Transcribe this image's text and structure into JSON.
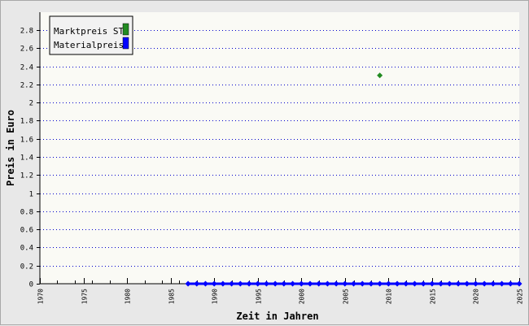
{
  "chart_data": {
    "type": "scatter",
    "title": "",
    "xlabel": "Zeit in Jahren",
    "ylabel": "Preis in Euro",
    "xlim": [
      1970,
      2025
    ],
    "ylim": [
      0,
      2.8
    ],
    "x_ticks": [
      1970,
      1975,
      1980,
      1985,
      1990,
      1995,
      2000,
      2005,
      2010,
      2015,
      2020,
      2025
    ],
    "y_ticks": [
      "0",
      "0.2",
      "0.4",
      "0.6",
      "0.8",
      "1",
      "1.2",
      "1.4",
      "1.6",
      "1.8",
      "2",
      "2.2",
      "2.4",
      "2.6",
      "2.8"
    ],
    "grid": "horizontal dotted",
    "legend_position": "top-left",
    "series": [
      {
        "name": "Marktpreis ST",
        "color": "#228b22",
        "points": [
          [
            2009,
            2.3
          ]
        ]
      },
      {
        "name": "Materialpreis",
        "color": "#0000ff",
        "points": [
          [
            1987,
            0
          ],
          [
            1988,
            0
          ],
          [
            1989,
            0
          ],
          [
            1990,
            0
          ],
          [
            1991,
            0
          ],
          [
            1992,
            0
          ],
          [
            1993,
            0
          ],
          [
            1994,
            0
          ],
          [
            1995,
            0
          ],
          [
            1996,
            0
          ],
          [
            1997,
            0
          ],
          [
            1998,
            0
          ],
          [
            1999,
            0
          ],
          [
            2000,
            0
          ],
          [
            2001,
            0
          ],
          [
            2002,
            0
          ],
          [
            2003,
            0
          ],
          [
            2004,
            0
          ],
          [
            2005,
            0
          ],
          [
            2006,
            0
          ],
          [
            2007,
            0
          ],
          [
            2008,
            0
          ],
          [
            2009,
            0
          ],
          [
            2010,
            0
          ],
          [
            2011,
            0
          ],
          [
            2012,
            0
          ],
          [
            2013,
            0
          ],
          [
            2014,
            0
          ],
          [
            2015,
            0
          ],
          [
            2016,
            0
          ],
          [
            2017,
            0
          ],
          [
            2018,
            0
          ],
          [
            2019,
            0
          ],
          [
            2020,
            0
          ],
          [
            2021,
            0
          ],
          [
            2022,
            0
          ],
          [
            2023,
            0
          ],
          [
            2024,
            0
          ],
          [
            2025,
            0
          ]
        ]
      }
    ]
  }
}
